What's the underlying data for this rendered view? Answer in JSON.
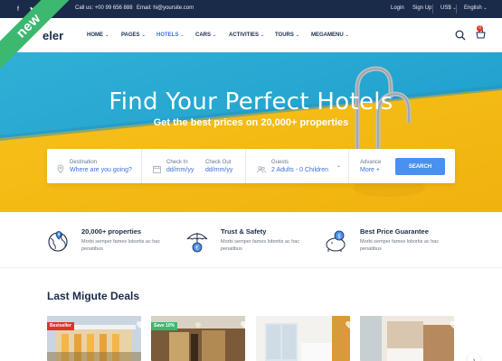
{
  "ribbon": {
    "label": "new",
    "color": "#3cb870"
  },
  "topbar": {
    "phone": "Call us: +00 99 656 888",
    "email": "Email: hi@yoursite.com",
    "links": [
      "Login",
      "Sign Up"
    ],
    "currency": "US$",
    "language": "English",
    "social_icons": [
      "facebook-icon",
      "twitter-icon"
    ]
  },
  "header": {
    "logo": "eler",
    "nav": [
      "HOME",
      "PAGES",
      "HOTELS",
      "CARS",
      "ACTIVITIES",
      "TOURS",
      "MEGAMENU"
    ],
    "active_nav": "HOTELS",
    "cart_count": "0",
    "icons": [
      "search-icon",
      "cart-icon"
    ]
  },
  "hero": {
    "title": "Find Your Perfect Hotels",
    "subtitle": "Get the best prices on 20,000+ properties"
  },
  "search": {
    "destination_label": "Destination",
    "destination_placeholder": "Where are you going?",
    "checkin_label": "Check In",
    "checkin_placeholder": "dd/mm/yy",
    "checkout_label": "Check Out",
    "checkout_placeholder": "dd/mm/yy",
    "guests_label": "Guests",
    "guests_value": "2 Adults - 0 Children",
    "advance_label": "Advance",
    "advance_value": "More +",
    "button": "SEARCH"
  },
  "features": [
    {
      "title": "20,000+ properties",
      "desc": "Morbi semper fames lobortis ac hac penatibus",
      "icon": "globe-pin-icon"
    },
    {
      "title": "Trust & Safety",
      "desc": "Morbi semper fames lobortis ac hac penatibus",
      "icon": "umbrella-icon"
    },
    {
      "title": "Best Price Guarantee",
      "desc": "Morbi semper fames lobortis ac hac penatibus",
      "icon": "piggy-bank-icon"
    }
  ],
  "deals": {
    "title": "Last Migute Deals",
    "cards": [
      {
        "badge": "Bestseller",
        "badge_color": "#e0322b"
      },
      {
        "badge": "Save 10%",
        "badge_color": "#3cb870"
      },
      {
        "badge": "",
        "badge_color": ""
      },
      {
        "badge": "",
        "badge_color": ""
      }
    ]
  },
  "colors": {
    "navy": "#1a2b49",
    "accent": "#3b6fe0",
    "button": "#4a90f0"
  }
}
